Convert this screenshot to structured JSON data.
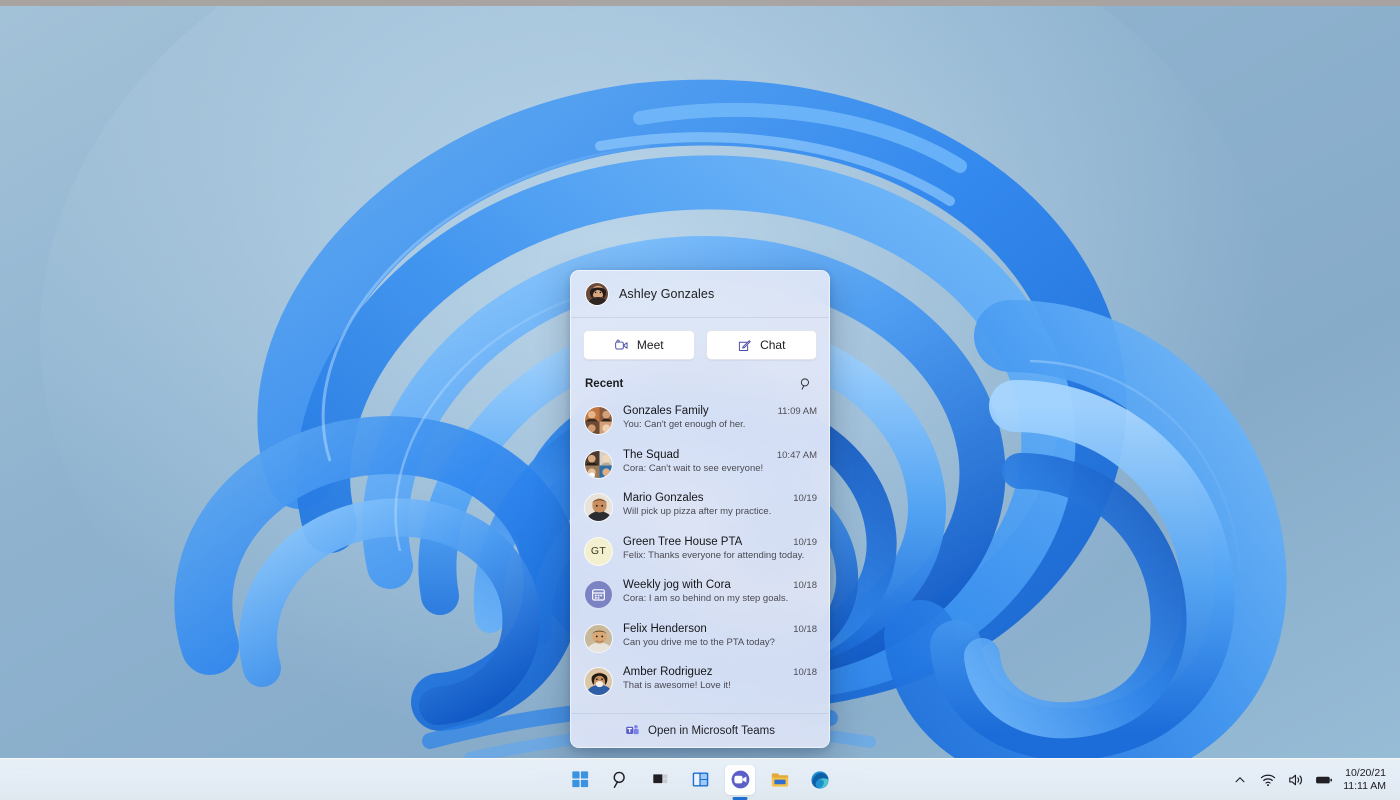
{
  "desktop": {
    "wallpaper_name": "windows-11-bloom-wallpaper",
    "background_color": "#8fb2cd",
    "top_band_color": "#a8a39f"
  },
  "chat_panel": {
    "user": {
      "name": "Ashley Gonzales",
      "avatar": "user-photo-avatar"
    },
    "actions": [
      {
        "label": "Meet",
        "icon": "video-camera-icon"
      },
      {
        "label": "Chat",
        "icon": "compose-message-icon"
      }
    ],
    "recent": {
      "title": "Recent",
      "search_icon": "search-icon"
    },
    "conversations": [
      {
        "name": "Gonzales Family",
        "preview": "You: Can't get enough of her.",
        "time": "11:09 AM",
        "avatar_type": "group-photo",
        "avatar_colors": [
          "#c2763f",
          "#8a5b3e",
          "#6c4a33",
          "#d2a078"
        ]
      },
      {
        "name": "The Squad",
        "preview": "Cora: Can't wait to see everyone!",
        "time": "10:47 AM",
        "avatar_type": "group-photo",
        "avatar_colors": [
          "#4a3a2e",
          "#d8cfc6",
          "#9a7a5c",
          "#2f6fa8"
        ]
      },
      {
        "name": "Mario Gonzales",
        "preview": "Will pick up pizza after my practice.",
        "time": "10/19",
        "avatar_type": "person-photo",
        "avatar_colors": [
          "#8a5a3a",
          "#3b2b22",
          "#e0c3a4",
          "#1f1b18"
        ]
      },
      {
        "name": "Green Tree House PTA",
        "preview": "Felix: Thanks everyone for attending today.",
        "time": "10/19",
        "avatar_type": "initials",
        "initials": "GT",
        "avatar_bg": "#f2f0cf",
        "avatar_fg": "#3a3a28"
      },
      {
        "name": "Weekly jog with Cora",
        "preview": "Cora: I am so behind on my step goals.",
        "time": "10/18",
        "avatar_type": "calendar-icon",
        "avatar_bg": "#7b83c4"
      },
      {
        "name": "Felix Henderson",
        "preview": "Can you drive me to the PTA today?",
        "time": "10/18",
        "avatar_type": "person-photo",
        "avatar_colors": [
          "#b98e5e",
          "#2a2520",
          "#e6cfae",
          "#7d6a52"
        ]
      },
      {
        "name": "Amber Rodriguez",
        "preview": "That is awesome! Love it!",
        "time": "10/18",
        "avatar_type": "person-photo",
        "avatar_colors": [
          "#c49a6c",
          "#241c18",
          "#f0e2d2",
          "#3a5fa8"
        ]
      }
    ],
    "footer": {
      "label": "Open in Microsoft Teams",
      "icon": "microsoft-teams-icon"
    }
  },
  "taskbar": {
    "buttons": [
      {
        "name": "start",
        "icon": "windows-start-icon"
      },
      {
        "name": "search",
        "icon": "search-icon"
      },
      {
        "name": "task-view",
        "icon": "task-view-icon"
      },
      {
        "name": "widgets",
        "icon": "widgets-icon"
      },
      {
        "name": "chat",
        "icon": "teams-chat-icon",
        "active": true
      },
      {
        "name": "file-explorer",
        "icon": "folder-icon"
      },
      {
        "name": "edge",
        "icon": "edge-browser-icon"
      }
    ],
    "tray": {
      "show_hidden_icons": "chevron-up-icon",
      "network": "wifi-icon",
      "volume": "speaker-icon",
      "battery": "battery-icon",
      "date": "10/20/21",
      "time": "11:11 AM"
    }
  }
}
